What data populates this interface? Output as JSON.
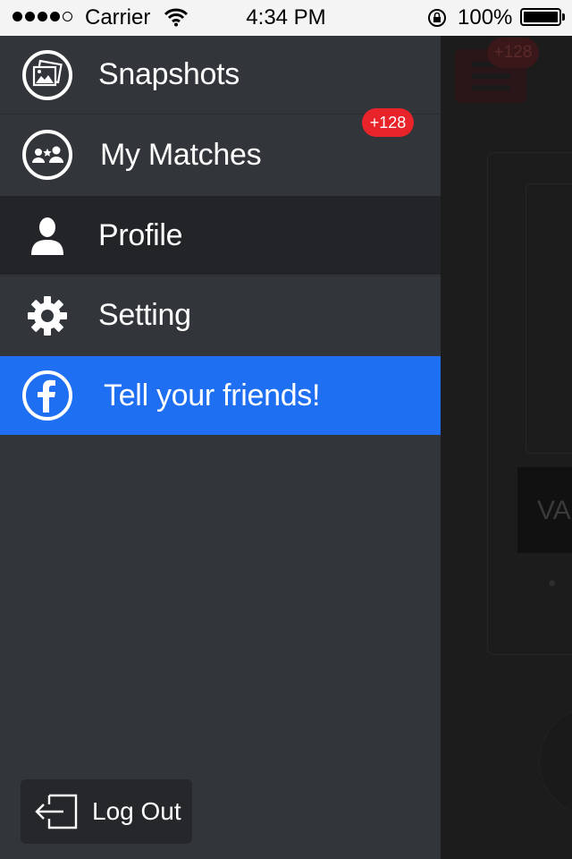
{
  "status_bar": {
    "carrier": "Carrier",
    "time": "4:34 PM",
    "battery": "100%"
  },
  "menu": {
    "items": [
      {
        "label": "Snapshots",
        "icon": "photos-icon"
      },
      {
        "label": "My Matches",
        "icon": "matches-icon",
        "badge": "+128"
      },
      {
        "label": "Profile",
        "icon": "person-icon",
        "selected": true
      },
      {
        "label": "Setting",
        "icon": "gear-icon"
      }
    ],
    "facebook": {
      "label": "Tell your friends!",
      "icon": "facebook-icon",
      "color": "#1f6ff2"
    },
    "logout": {
      "label": "Log Out",
      "icon": "logout-icon"
    }
  },
  "background": {
    "badge": "+128",
    "text": "VA"
  },
  "colors": {
    "menu_bg": "#32363b",
    "selected_bg": "#232428",
    "badge_red": "#e8232a"
  }
}
